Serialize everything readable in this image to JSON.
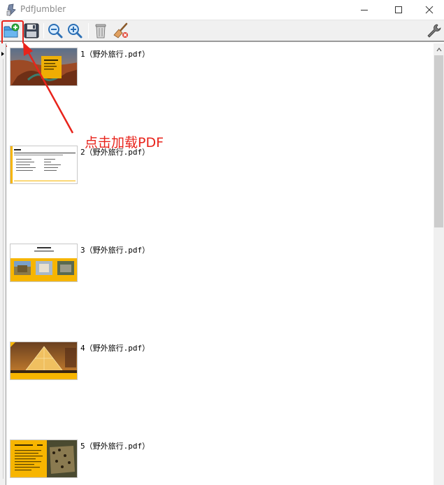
{
  "window": {
    "title": "PdfJumbler"
  },
  "toolbar": {
    "buttons": [
      {
        "name": "open-file-button",
        "icon": "folder-add-icon"
      },
      {
        "name": "save-button",
        "icon": "floppy-disk-icon"
      },
      {
        "name": "zoom-out-button",
        "icon": "zoom-out-icon"
      },
      {
        "name": "zoom-in-button",
        "icon": "zoom-in-icon"
      },
      {
        "name": "delete-button",
        "icon": "trash-icon"
      },
      {
        "name": "clear-button",
        "icon": "broom-icon"
      },
      {
        "name": "settings-button",
        "icon": "wrench-icon"
      }
    ]
  },
  "pages": [
    {
      "label": "1（野外旅行.pdf）",
      "thumb": "canyon"
    },
    {
      "label": "2（野外旅行.pdf）",
      "thumb": "text-doc"
    },
    {
      "label": "3（野外旅行.pdf）",
      "thumb": "three-photos"
    },
    {
      "label": "4（野外旅行.pdf）",
      "thumb": "pyramid"
    },
    {
      "label": "5（野外旅行.pdf）",
      "thumb": "leopard"
    }
  ],
  "annotation": {
    "text": "点击加载PDF",
    "color": "#e8231b"
  },
  "colors": {
    "accent_yellow": "#f7b500",
    "highlight_red": "#e8231b"
  }
}
